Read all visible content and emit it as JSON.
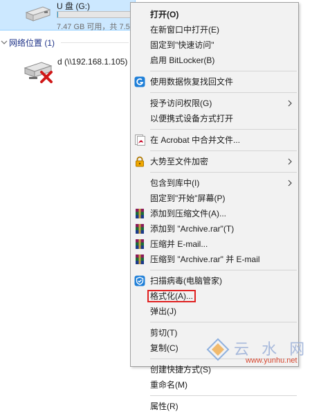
{
  "explorer": {
    "drive": {
      "name": "U 盘 (G:)",
      "space_text": "7.47 GB 可用，共 7.5",
      "used_fraction": 0.01,
      "icon": "usb-drive-icon"
    },
    "network_group": {
      "label": "网络位置 (1)",
      "item_name": "d (\\\\192.168.1.105) (",
      "icon": "network-drive-disconnected-icon"
    }
  },
  "context_menu": {
    "open": "打开(O)",
    "open_new_window": "在新窗口中打开(E)",
    "pin_quick_access": "固定到\"快速访问\"",
    "enable_bitlocker": "启用 BitLocker(B)",
    "recover_files": "使用数据恢复找回文件",
    "grant_access": "授予访问权限(G)",
    "open_portable": "以便携式设备方式打开",
    "acrobat_merge": "在 Acrobat 中合并文件...",
    "encrypt": "大势至文件加密",
    "include_library": "包含到库中(I)",
    "pin_start": "固定到\"开始\"屏幕(P)",
    "add_archive": "添加到压缩文件(A)...",
    "add_archive_rar": "添加到 \"Archive.rar\"(T)",
    "compress_email": "压缩并 E-mail...",
    "compress_rar_email": "压缩到 \"Archive.rar\" 并 E-mail",
    "scan_virus": "扫描病毒(电脑管家)",
    "format": "格式化(A)...",
    "eject": "弹出(J)",
    "cut": "剪切(T)",
    "copy": "复制(C)",
    "create_shortcut": "创建快捷方式(S)",
    "rename": "重命名(M)",
    "properties": "属性(R)"
  },
  "colors": {
    "selection_bg": "#cce8ff",
    "highlight_box": "#e02020",
    "group_header": "#1e3287"
  },
  "watermark": {
    "text": "云 水 网",
    "url": "www.yunhu.net"
  }
}
